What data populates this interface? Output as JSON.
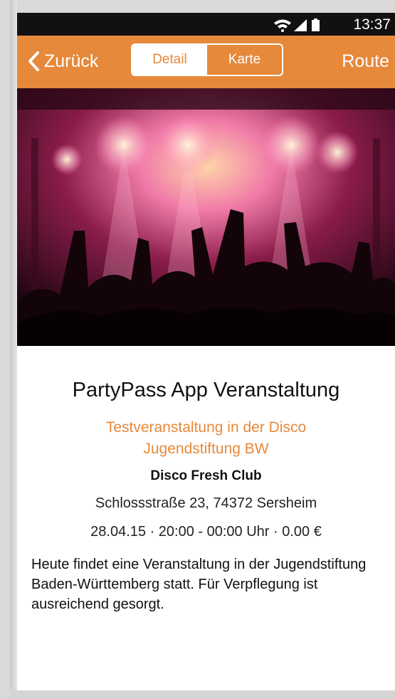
{
  "status": {
    "time": "13:37"
  },
  "nav": {
    "back_label": "Zurück",
    "segments": [
      {
        "label": "Detail",
        "active": true
      },
      {
        "label": "Karte",
        "active": false
      }
    ],
    "route_label": "Route",
    "accent": "#e6893a"
  },
  "hero": {
    "image": "concert crowd with stage lights"
  },
  "event": {
    "title": "PartyPass App Veranstaltung",
    "subtitle": "Testveranstaltung in der Disco Jugendstiftung BW",
    "venue": "Disco Fresh Club",
    "address": "Schlossstraße 23, 74372 Sersheim",
    "when": "28.04.15 · 20:00 - 00:00 Uhr · 0.00 €",
    "description": "Heute findet eine Veranstaltung in der Jugendstiftung Baden-Württemberg statt. Für Verpflegung ist ausreichend gesorgt."
  }
}
